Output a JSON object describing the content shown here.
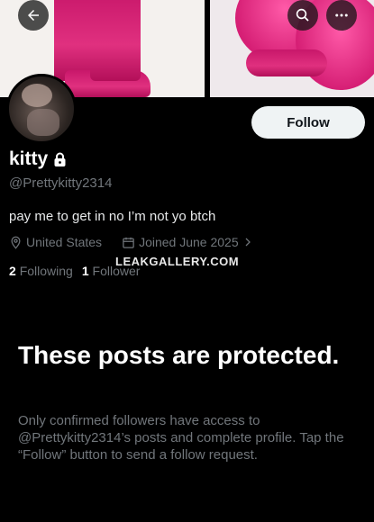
{
  "profile": {
    "name": "kitty",
    "handle": "@Prettykitty2314",
    "bio": "pay me to get in no I’m not yo btch",
    "location": "United States",
    "joined": "Joined June 2025",
    "following_count": "2",
    "following_label": "Following",
    "followers_count": "1",
    "followers_label": "Follower",
    "follow_button": "Follow"
  },
  "watermark": "LEAKGALLERY.COM",
  "protected": {
    "title": "These posts are protected.",
    "description": "Only confirmed followers have access to @Prettykitty2314’s posts and complete profile. Tap the “Follow” button to send a follow request."
  },
  "icons": [
    "back-arrow-icon",
    "search-icon",
    "more-icon",
    "lock-icon",
    "location-pin-icon",
    "calendar-icon",
    "chevron-right-icon"
  ]
}
